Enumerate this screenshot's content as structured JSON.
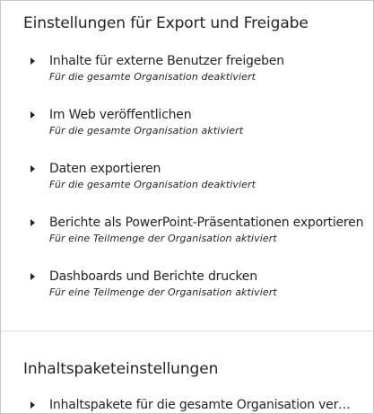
{
  "export_section": {
    "title": "Einstellungen für Export und Freigabe",
    "items": [
      {
        "label": "Inhalte für externe Benutzer freigeben",
        "status": "Für die gesamte Organisation deaktiviert"
      },
      {
        "label": "Im Web veröffentlichen",
        "status": "Für die gesamte Organisation aktiviert"
      },
      {
        "label": "Daten exportieren",
        "status": "Für die gesamte Organisation deaktiviert"
      },
      {
        "label": "Berichte als PowerPoint-Präsentationen exportieren",
        "status": "Für eine Teilmenge der Organisation aktiviert"
      },
      {
        "label": "Dashboards und Berichte drucken",
        "status": "Für eine Teilmenge der Organisation aktiviert"
      }
    ]
  },
  "content_pack_section": {
    "title": "Inhaltspaketeinstellungen",
    "items": [
      {
        "label": "Inhaltspakete für die gesamte Organisation veröffe..."
      }
    ]
  }
}
